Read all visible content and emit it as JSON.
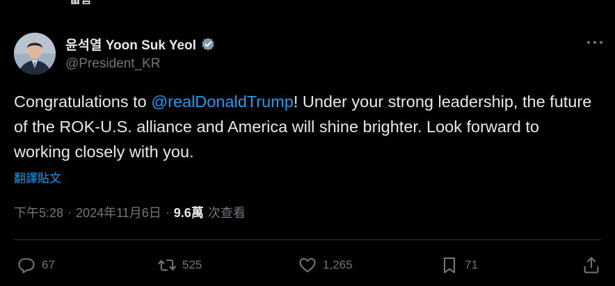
{
  "top_stub": "留言",
  "author": {
    "name": "윤석열 Yoon Suk Yeol",
    "handle": "@President_KR"
  },
  "tweet": {
    "text_before": "Congratulations to ",
    "mention": "@realDonaldTrump",
    "text_after": "! Under your strong leadership, the future of the ROK-U.S. alliance and America will shine brighter. Look forward to working closely with you."
  },
  "translate_label": "翻譯貼文",
  "meta": {
    "time": "下午5:28",
    "separator": "·",
    "date": "2024年11月6日",
    "views_count": "9.6萬",
    "views_label": "次查看"
  },
  "actions": {
    "reply_count": "67",
    "retweet_count": "525",
    "like_count": "1,265",
    "bookmark_count": "71"
  },
  "colors": {
    "background": "#000000",
    "text": "#e7e9ea",
    "secondary": "#71767b",
    "accent": "#1d9bf0",
    "divider": "#2f3336"
  },
  "icons": {
    "verified": "verified-badge-icon",
    "more": "more-icon",
    "reply": "reply-icon",
    "retweet": "retweet-icon",
    "like": "heart-icon",
    "bookmark": "bookmark-icon",
    "share": "share-icon"
  }
}
